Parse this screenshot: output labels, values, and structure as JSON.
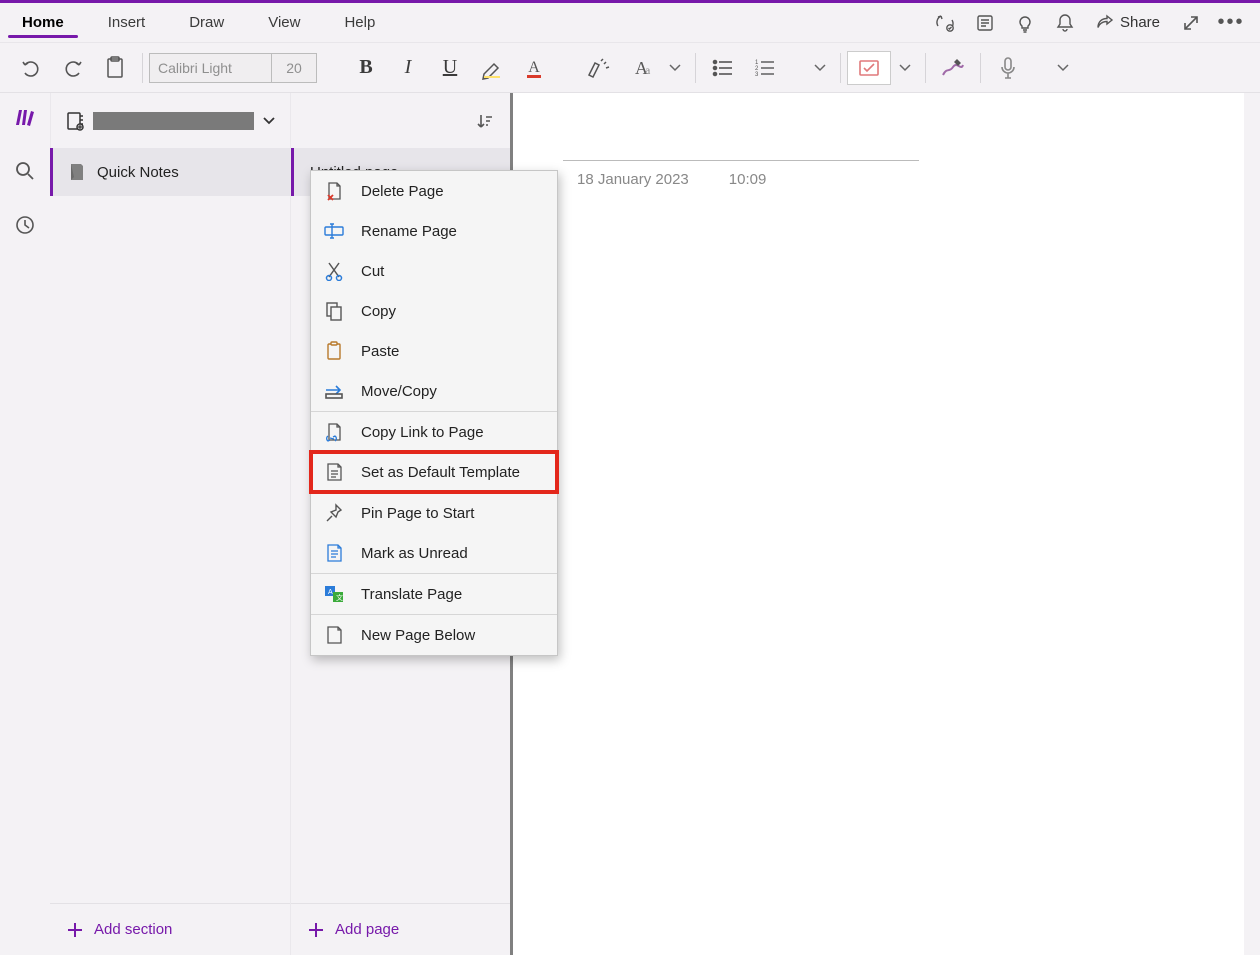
{
  "tabs": {
    "items": [
      "Home",
      "Insert",
      "Draw",
      "View",
      "Help"
    ],
    "active_index": 0,
    "share_label": "Share"
  },
  "ribbon": {
    "font_name": "Calibri Light",
    "font_size": "20"
  },
  "rail": {
    "notebooks_active": true
  },
  "notebook": {
    "chevron": "⌄"
  },
  "sections": {
    "items": [
      {
        "label": "Quick Notes"
      }
    ],
    "add_label": "Add section"
  },
  "pages": {
    "items": [
      {
        "label": "Untitled page"
      }
    ],
    "add_label": "Add page"
  },
  "canvas": {
    "date": "18 January 2023",
    "time": "10:09"
  },
  "context_menu": {
    "items": [
      {
        "label": "Delete Page",
        "icon": "delete-page-icon"
      },
      {
        "label": "Rename Page",
        "icon": "rename-icon"
      },
      {
        "label": "Cut",
        "icon": "cut-icon"
      },
      {
        "label": "Copy",
        "icon": "copy-icon"
      },
      {
        "label": "Paste",
        "icon": "paste-icon"
      },
      {
        "label": "Move/Copy",
        "icon": "move-icon"
      },
      {
        "label": "Copy Link to Page",
        "icon": "copy-link-icon",
        "sep_before": true
      },
      {
        "label": "Set as Default Template",
        "icon": "template-icon",
        "highlight": true
      },
      {
        "label": "Pin Page to Start",
        "icon": "pin-icon",
        "sep_before": true
      },
      {
        "label": "Mark as Unread",
        "icon": "unread-icon"
      },
      {
        "label": "Translate Page",
        "icon": "translate-icon",
        "sep_before": true
      },
      {
        "label": "New Page Below",
        "icon": "new-page-icon",
        "sep_before": true
      }
    ]
  }
}
